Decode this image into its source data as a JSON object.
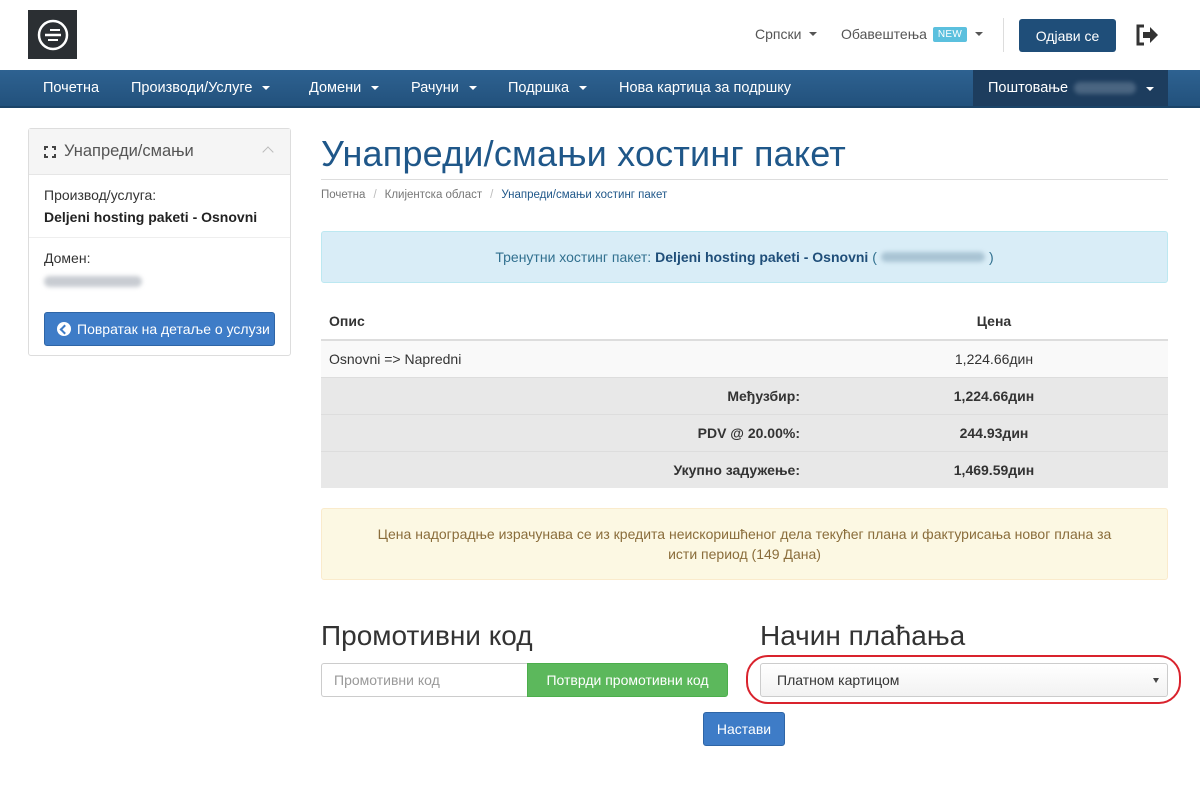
{
  "header": {
    "language": "Српски",
    "notifications": "Обавештења",
    "new_badge": "NEW",
    "logout": "Одјави се"
  },
  "nav": {
    "items": [
      {
        "label": "Почетна"
      },
      {
        "label": "Производи/Услуге"
      },
      {
        "label": "Домени"
      },
      {
        "label": "Рачуни"
      },
      {
        "label": "Подршка"
      },
      {
        "label": "Нова картица за подршку"
      }
    ],
    "greeting": "Поштовање"
  },
  "sidebar": {
    "title": "Унапреди/смањи",
    "product_label": "Производ/услуга:",
    "product_value": "Deljeni hosting paketi - Osnovni",
    "domain_label": "Домен:",
    "back_button": "Повратак на детаље о услузи"
  },
  "main": {
    "title": "Унапреди/смањи хостинг пакет",
    "breadcrumb": [
      "Почетна",
      "Клијентска област",
      "Унапреди/смањи хостинг пакет"
    ],
    "current_package_label": "Тренутни хостинг пакет:",
    "current_package_value": "Deljeni hosting paketi - Osnovni",
    "table": {
      "col_description": "Опис",
      "col_price": "Цена",
      "item": {
        "description": "Osnovni => Napredni",
        "price": "1,224.66дин"
      },
      "subtotal": {
        "label": "Међузбир:",
        "value": "1,224.66дин"
      },
      "tax": {
        "label": "PDV @ 20.00%:",
        "value": "244.93дин"
      },
      "total": {
        "label": "Укупно задужење:",
        "value": "1,469.59дин"
      }
    },
    "notice": "Цена надоградње израчунава се из кредита неискоришћеног дела текућег плана и фактурисања новог плана за исти период (149 Дана)",
    "promo_heading": "Промотивни код",
    "promo_placeholder": "Промотивни код",
    "promo_button": "Потврди промотивни код",
    "payment_heading": "Начин плаћања",
    "payment_selected": "Платном картицом",
    "continue_button": "Настави"
  },
  "colors": {
    "navbar": "#2e6291",
    "primary": "#3e7cc7",
    "title": "#1f5789",
    "success": "#5cb85c",
    "highlight": "#d9232d"
  }
}
